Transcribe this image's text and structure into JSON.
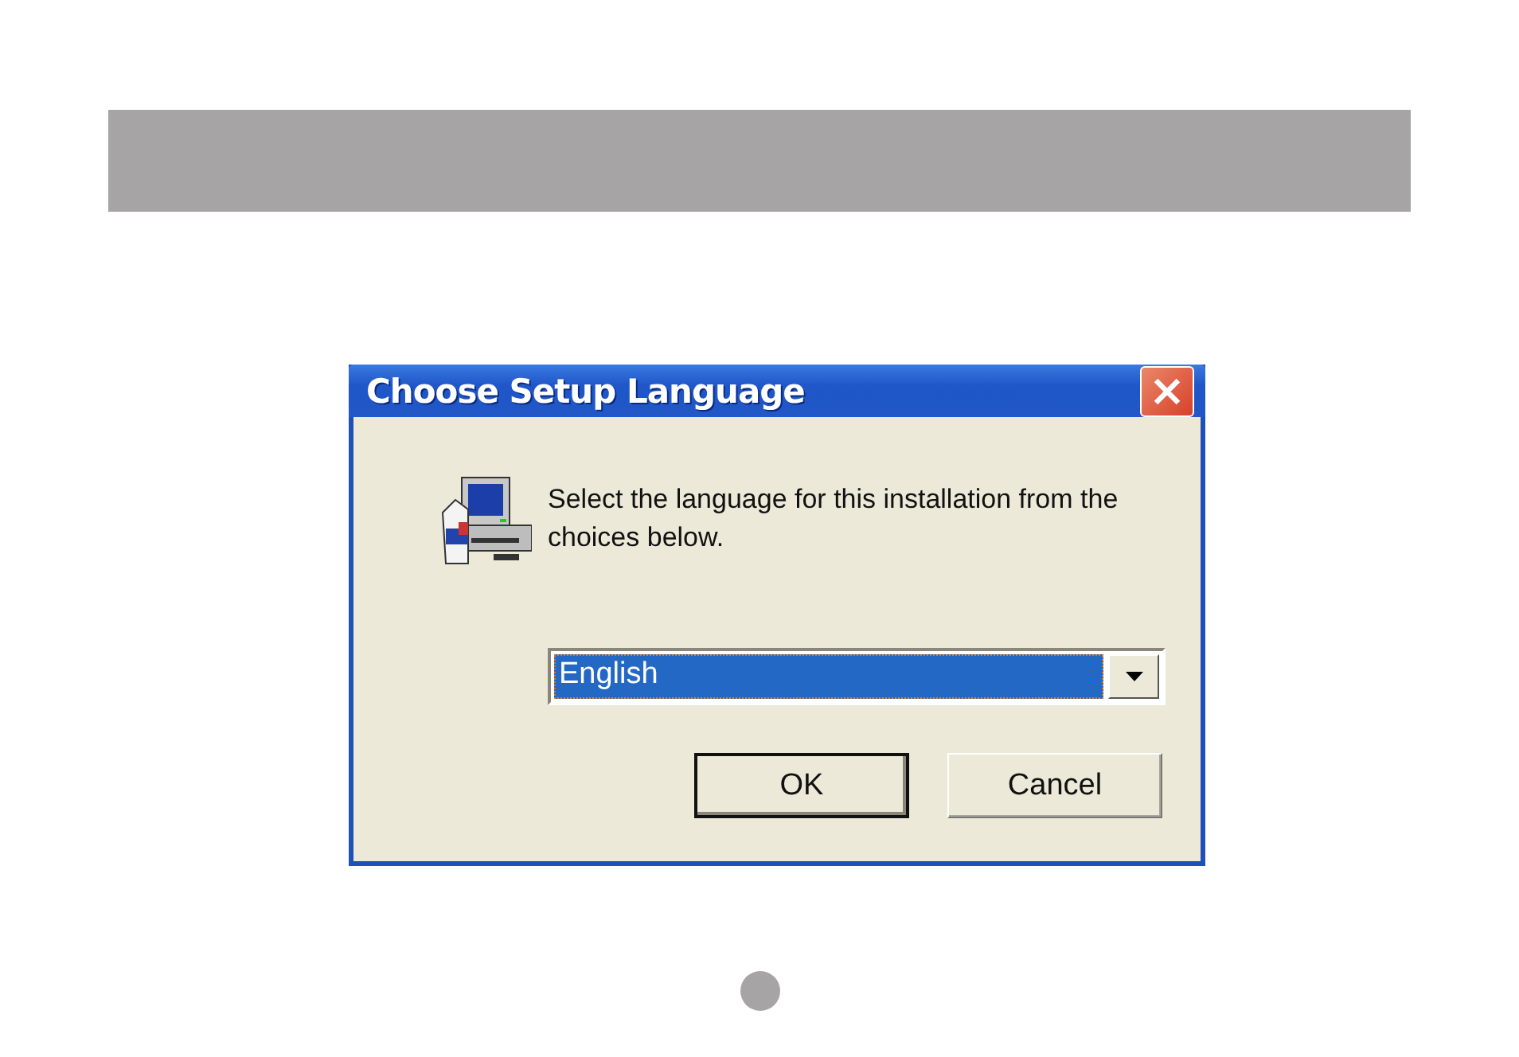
{
  "window": {
    "title": "Choose Setup Language"
  },
  "message": "Select the language for this installation from the choices below.",
  "language_select": {
    "value": "English",
    "focused": true
  },
  "buttons": [
    {
      "label": "OK",
      "default": true
    },
    {
      "label": "Cancel",
      "default": false
    }
  ]
}
